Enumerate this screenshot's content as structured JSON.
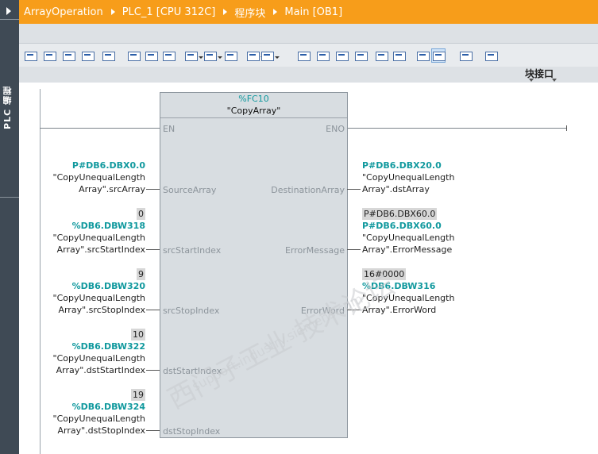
{
  "sidebar": {
    "label": "PLC 编程"
  },
  "breadcrumb": [
    "ArrayOperation",
    "PLC_1 [CPU 312C]",
    "程序块",
    "Main [OB1]"
  ],
  "toolbar": {
    "icons": [
      "insert-network-icon",
      "delete-network-icon",
      "insert-row-icon",
      "add-row-icon",
      "reset-start-values-icon",
      "select-all-icon",
      "open-all-networks-icon",
      "close-all-networks-icon",
      "comments-toggle-icon",
      "absolute-operands-icon",
      "favorites-icon",
      "list-icon",
      "go-to-previous-error-icon",
      "go-to-next-error-icon",
      "update-calls-icon",
      "block-call-icon",
      "compare-icon",
      "monitor-icon",
      "set-value-icon",
      "display-operands-icon",
      "call-hierarchy-icon",
      "monitoring-on-off-icon",
      "block-interface-icon"
    ]
  },
  "interface_bar": {
    "label": "块接口"
  },
  "block": {
    "instance": "%FC10",
    "name": "\"CopyArray\"",
    "pins_left": [
      "EN",
      "SourceArray",
      "srcStartIndex",
      "srcStopIndex",
      "dstStartIndex",
      "dstStopIndex"
    ],
    "pins_right": [
      "ENO",
      "DestinationArray",
      "ErrorMessage",
      "ErrorWord"
    ]
  },
  "operands_left": [
    {
      "value": "",
      "address": "P#DB6.DBX0.0",
      "line1": "\"CopyUnequalLength",
      "line2": "Array\".srcArray"
    },
    {
      "value": "0",
      "address": "%DB6.DBW318",
      "line1": "\"CopyUnequalLength",
      "line2": "Array\".srcStartIndex"
    },
    {
      "value": "9",
      "address": "%DB6.DBW320",
      "line1": "\"CopyUnequalLength",
      "line2": "Array\".srcStopIndex"
    },
    {
      "value": "10",
      "address": "%DB6.DBW322",
      "line1": "\"CopyUnequalLength",
      "line2": "Array\".dstStartIndex"
    },
    {
      "value": "19",
      "address": "%DB6.DBW324",
      "line1": "\"CopyUnequalLength",
      "line2": "Array\".dstStopIndex"
    }
  ],
  "operands_right": [
    {
      "value": "",
      "address": "P#DB6.DBX20.0",
      "line1": "\"CopyUnequalLength",
      "line2": "Array\".dstArray"
    },
    {
      "value": "P#DB6.DBX60.0",
      "address": "P#DB6.DBX60.0",
      "line1": "\"CopyUnequalLength",
      "line2": "Array\".ErrorMessage"
    },
    {
      "value": "16#0000",
      "address": "%DB6.DBW316",
      "line1": "\"CopyUnequalLength",
      "line2": "Array\".ErrorWord"
    }
  ],
  "watermark": {
    "text": "西门子工业 技术论坛",
    "url": "support.industry.siemens.com"
  },
  "colors": {
    "accent": "#f79d1a",
    "address": "#11999e",
    "sidebar": "#3f4a55"
  }
}
